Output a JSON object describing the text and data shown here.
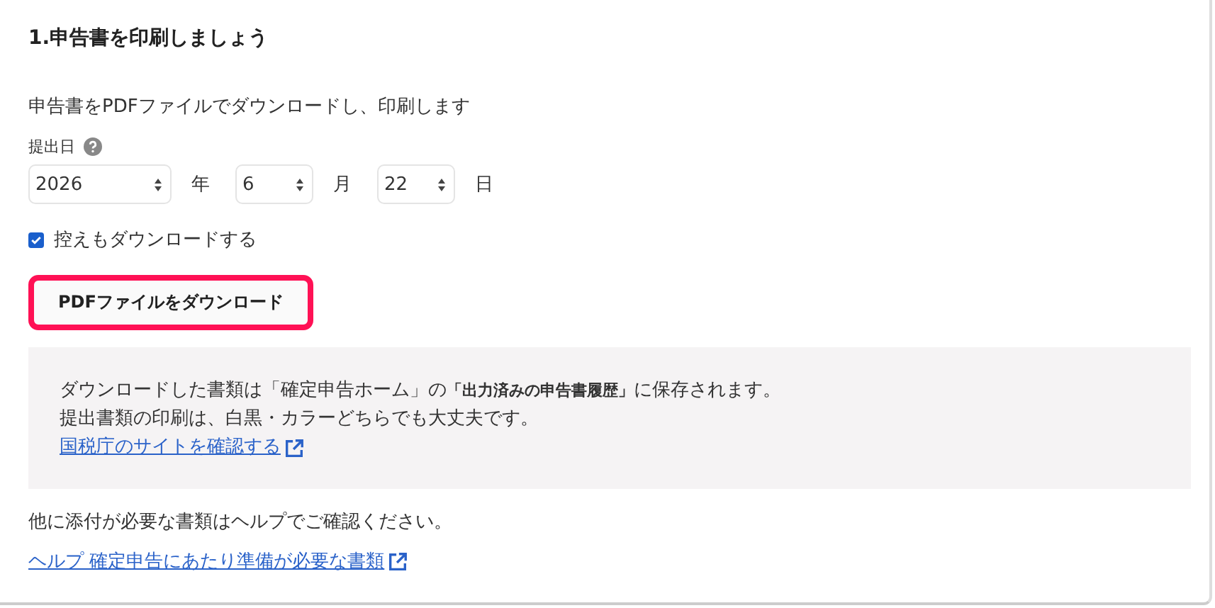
{
  "heading": "1.申告書を印刷しましょう",
  "description": "申告書をPDFファイルでダウンロードし、印刷します",
  "date_field": {
    "label": "提出日",
    "parts": [
      {
        "value": "2026",
        "unit": "年"
      },
      {
        "value": "6",
        "unit": "月"
      },
      {
        "value": "22",
        "unit": "日"
      }
    ]
  },
  "copy_checkbox": {
    "label": "控えもダウンロードする",
    "checked": true
  },
  "download_button": {
    "label": "PDFファイルをダウンロード",
    "highlighted": true
  },
  "info_box": {
    "lines": [
      "ダウンロードした書類は「確定申告ホーム」の**「出力済みの申告書履歴」**に保存されます。",
      "提出書類の印刷は、白黒・カラーどちらでも大丈夫です。"
    ],
    "link": "国税庁のサイトを確認する"
  },
  "note": "他に添付が必要な書類はヘルプでご確認ください。",
  "help_link": "ヘルプ 確定申告にあたり準備が必要な書類"
}
